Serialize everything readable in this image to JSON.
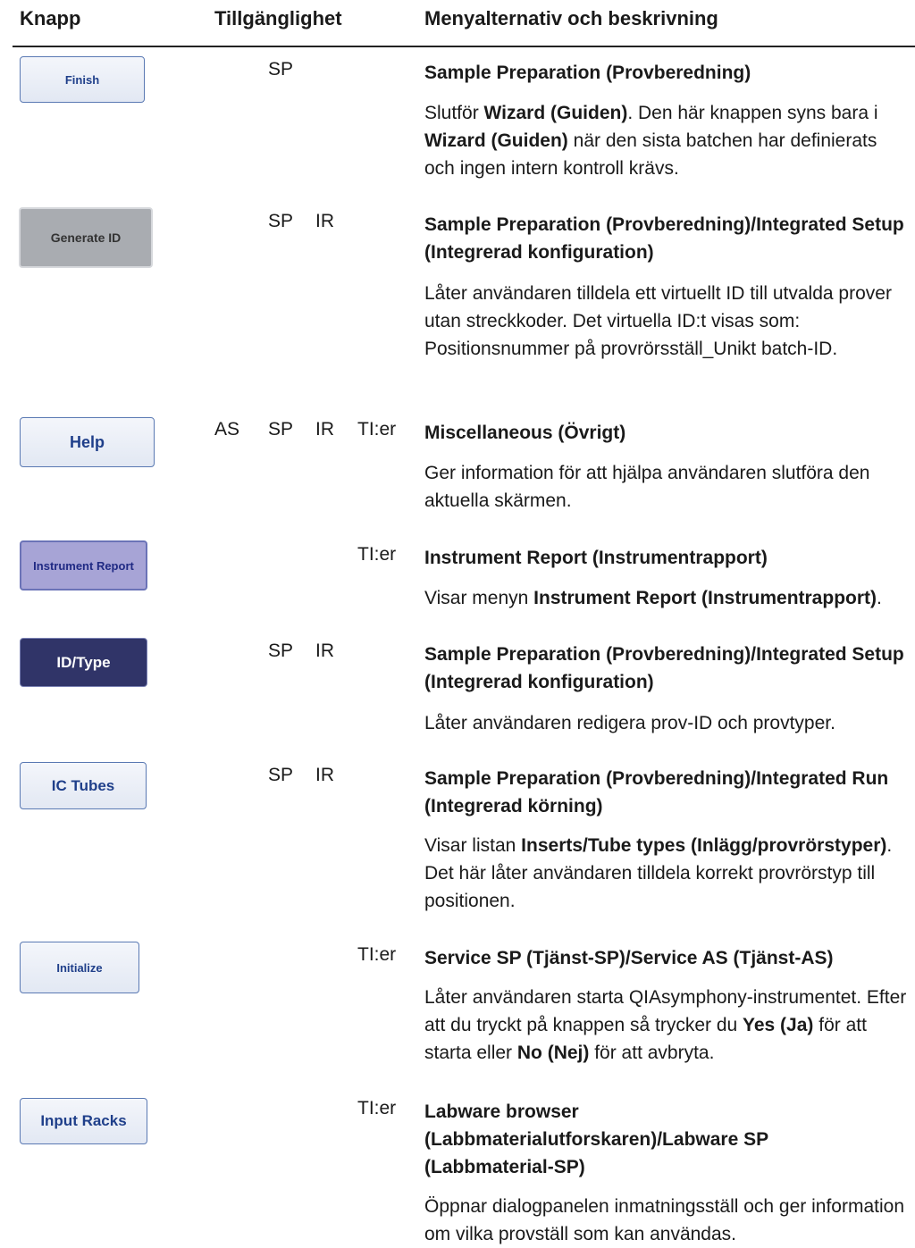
{
  "header": {
    "knapp": "Knapp",
    "tillganglighet": "Tillgänglighet",
    "menyalternativ": "Menyalternativ och beskrivning"
  },
  "rows": [
    {
      "button_label": "Finish",
      "availability": [
        "",
        "SP",
        "",
        ""
      ],
      "menu": "Sample Preparation (Provberedning)",
      "description": {
        "t1": "Slutför ",
        "b1": "Wizard (Guiden)",
        "t2": ". Den här knappen syns bara i ",
        "b2": "Wizard (Guiden)",
        "t3": " när den sista batchen har definierats och ingen intern kontroll krävs."
      }
    },
    {
      "button_label": "Generate ID",
      "availability": [
        "",
        "SP",
        "IR",
        ""
      ],
      "menu": "Sample Preparation (Provberedning)/Integrated Setup (Integrerad konfiguration)",
      "description": {
        "t1": "Låter användaren tilldela ett virtuellt ID till utvalda prover utan streckkoder. Det virtuella ID:t visas som: Positionsnummer på provrörsställ_Unikt batch-ID."
      }
    },
    {
      "button_label": "Help",
      "availability": [
        "AS",
        "SP",
        "IR",
        "TI:er"
      ],
      "menu": "Miscellaneous (Övrigt)",
      "description": {
        "t1": "Ger information för att hjälpa användaren slutföra den aktuella skärmen."
      }
    },
    {
      "button_label": "Instrument Report",
      "availability": [
        "",
        "",
        "",
        "TI:er"
      ],
      "menu": "Instrument Report (Instrumentrapport)",
      "description": {
        "t1": "Visar menyn ",
        "b1": "Instrument Report (Instrumentrapport)",
        "t2": "."
      }
    },
    {
      "button_label": "ID/Type",
      "availability": [
        "",
        "SP",
        "IR",
        ""
      ],
      "menu": "Sample Preparation (Provberedning)/Integrated Setup (Integrerad konfiguration)",
      "description": {
        "t1": "Låter användaren redigera prov-ID och provtyper."
      }
    },
    {
      "button_label": "IC Tubes",
      "availability": [
        "",
        "SP",
        "IR",
        ""
      ],
      "menu": "Sample Preparation (Provberedning)/Integrated Run (Integrerad körning)",
      "description": {
        "t1": "Visar listan ",
        "b1": "Inserts/Tube types (Inlägg/provrörstyper)",
        "t2": ". Det här låter användaren tilldela korrekt provrörstyp till positionen."
      }
    },
    {
      "button_label": "Initialize",
      "availability": [
        "",
        "",
        "",
        "TI:er"
      ],
      "menu": "Service SP (Tjänst-SP)/Service AS (Tjänst-AS)",
      "description": {
        "t1": "Låter användaren starta QIAsymphony-instrumentet. Efter att du tryckt på knappen så trycker du ",
        "b1": "Yes (Ja)",
        "t2": " för att starta eller ",
        "b2": "No (Nej)",
        "t3": " för att avbryta."
      }
    },
    {
      "button_label": "Input Racks",
      "availability": [
        "",
        "",
        "",
        "TI:er"
      ],
      "menu": "Labware browser (Labbmaterialutforskaren)/Labware SP (Labbmaterial-SP)",
      "description": {
        "t1": "Öppnar dialogpanelen inmatningsställ och ger information om vilka provställ som kan användas."
      }
    }
  ]
}
